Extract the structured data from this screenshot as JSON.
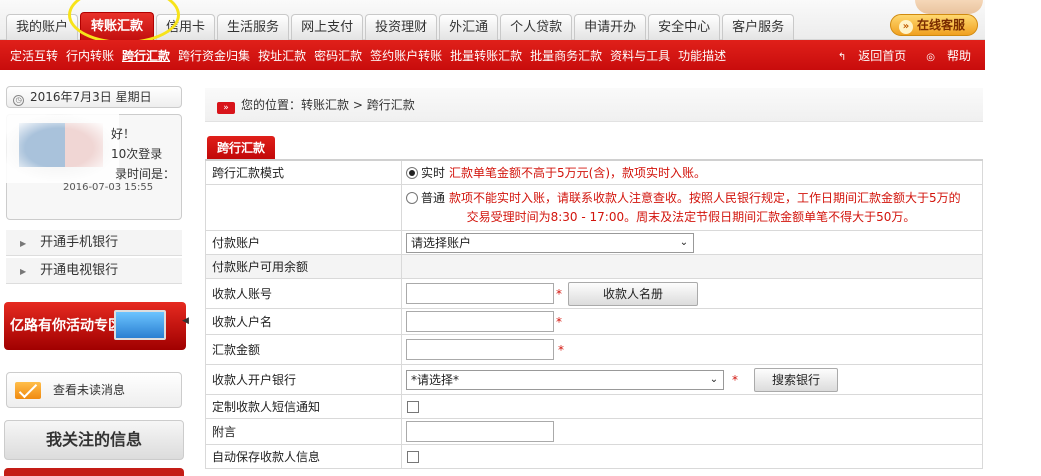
{
  "nav": {
    "tabs": [
      "我的账户",
      "转账汇款",
      "信用卡",
      "生活服务",
      "网上支付",
      "投资理财",
      "外汇通",
      "个人贷款",
      "申请开办",
      "安全中心",
      "客户服务"
    ],
    "active_tab": "转账汇款",
    "online_service": "在线客服",
    "online_service_icon": "»"
  },
  "subnav": {
    "items": [
      "定活互转",
      "行内转账",
      "跨行汇款",
      "跨行资金归集",
      "按址汇款",
      "密码汇款",
      "签约账户转账",
      "批量转账汇款",
      "批量商务汇款",
      "资料与工具",
      "功能描述"
    ],
    "current": "跨行汇款",
    "back_home": "返回首页",
    "help": "帮助"
  },
  "sidebar": {
    "date": "2016年7月3日 星期日",
    "welcome_line1": "好！",
    "welcome_line2": "10次登录",
    "welcome_line3": "录时间是：",
    "welcome_time": "2016-07-03 15:55",
    "links": [
      "开通手机银行",
      "开通电视银行"
    ],
    "promo": "亿路有你活动专区",
    "unread_msg": "查看未读消息",
    "follow": "我关注的信息"
  },
  "breadcrumb": {
    "prefix": "您的位置：",
    "path": "转账汇款 > 跨行汇款"
  },
  "section": {
    "tab": "跨行汇款"
  },
  "form": {
    "mode_label": "跨行汇款模式",
    "realtime_label": "实时",
    "realtime_note": "汇款单笔金额不高于5万元(含)，款项实时入账。",
    "normal_label": "普通",
    "normal_note_1": "款项不能实时入账，请联系收款人注意查收。按照人民银行规定，工作日期间汇款金额大于5万的",
    "normal_note_2": "交易受理时间为8:30 - 17:00。周末及法定节假日期间汇款金额单笔不得大于50万。",
    "pay_account_label": "付款账户",
    "pay_account_value": "请选择账户",
    "balance_label": "付款账户可用余额",
    "payee_account_label": "收款人账号",
    "payee_book_btn": "收款人名册",
    "payee_name_label": "收款人户名",
    "amount_label": "汇款金额",
    "payee_bank_label": "收款人开户银行",
    "payee_bank_value": "*请选择*",
    "search_bank_btn": "搜索银行",
    "sms_label": "定制收款人短信通知",
    "remark_label": "附言",
    "autosave_label": "自动保存收款人信息",
    "required_mark": "*"
  }
}
